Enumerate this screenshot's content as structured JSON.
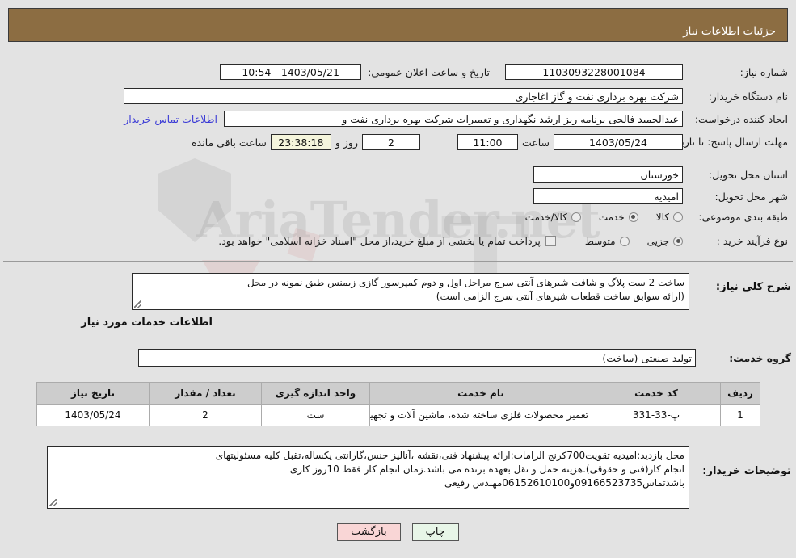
{
  "header": {
    "title": "جزئیات اطلاعات نیاز"
  },
  "form": {
    "need_number_label": "شماره نیاز:",
    "need_number_value": "1103093228001084",
    "announce_datetime_label": "تاریخ و ساعت اعلان عمومی:",
    "announce_datetime_value": "1403/05/21 - 10:54",
    "buyer_org_label": "نام دستگاه خریدار:",
    "buyer_org_value": "شرکت بهره برداری نفت و گاز اغاجاری",
    "requester_label": "ایجاد کننده درخواست:",
    "requester_value": "عبدالحمید فالحی برنامه ریز ارشد نگهداری و تعمیرات شرکت بهره برداری نفت و ",
    "contact_link": "اطلاعات تماس خریدار",
    "deadline_label": "مهلت ارسال پاسخ: تا تاریخ:",
    "deadline_date": "1403/05/24",
    "hour_label": "ساعت",
    "deadline_time": "11:00",
    "days_value": "2",
    "days_label": "روز و",
    "countdown_value": "23:38:18",
    "countdown_label": "ساعت باقی مانده",
    "province_label": "استان محل تحویل:",
    "province_value": "خوزستان",
    "city_label": "شهر محل تحویل:",
    "city_value": "امیدیه",
    "category_label": "طبقه بندی موضوعی:",
    "category_options": [
      {
        "label": "کالا",
        "selected": false
      },
      {
        "label": "خدمت",
        "selected": true
      },
      {
        "label": "کالا/خدمت",
        "selected": false
      }
    ],
    "process_label": "نوع فرآیند خرید :",
    "process_options": [
      {
        "label": "جزیی",
        "selected": true
      },
      {
        "label": "متوسط",
        "selected": false
      }
    ],
    "treasury_checkbox_label": "پرداخت تمام یا بخشی از مبلغ خرید،از محل \"اسناد خزانه اسلامی\" خواهد بود.",
    "treasury_checked": false
  },
  "description": {
    "label": "شرح کلی نیاز:",
    "value": "ساخت 2 ست پلاگ و شافت شیرهای آنتی سرج مراحل اول و دوم کمپرسور گازی زیمنس طبق نمونه در محل\n(ارائه سوابق ساخت قطعات شیرهای  آنتی سرج الزامی است)"
  },
  "services_section": {
    "title": "اطلاعات خدمات مورد نیاز",
    "group_label": "گروه خدمت:",
    "group_value": "تولید صنعتی (ساخت)"
  },
  "table": {
    "headers": [
      "ردیف",
      "کد خدمت",
      "نام خدمت",
      "واحد اندازه گیری",
      "تعداد / مقدار",
      "تاریخ نیاز"
    ],
    "rows": [
      {
        "index": "1",
        "code": "پ-33-331",
        "name": "تعمیر محصولات فلزی ساخته شده، ماشین آلات و تجهیزات",
        "unit": "ست",
        "quantity": "2",
        "need_date": "1403/05/24"
      }
    ]
  },
  "buyer_notes": {
    "label": "توضیحات خریدار:",
    "value": "محل بازدید:امیدیه تقویت700کرنج الزامات:ارائه پیشنهاد فنی،نقشه ،آنالیز جنس،گارانتی یکساله،تقبل کلیه مسئولیتهای\nانجام کار(فنی و حقوقی).هزینه حمل و نقل بعهده برنده می باشد.زمان انجام کار فقط 10روز کاری\nباشدتماس09166523735و06152610100مهندس رفیعی"
  },
  "footer": {
    "back_label": "بازگشت",
    "print_label": "چاپ"
  },
  "watermark": {
    "text": "AriaTender.net",
    "letter": "T"
  },
  "colors": {
    "header_brown": "#8c6d42",
    "link_blue": "#3b3bd6",
    "timer_cream": "#f5f5dc",
    "back_pink": "#f9d6d6",
    "print_green": "#e8f6e8",
    "table_header_gray": "#cdcdcd",
    "page_bg": "#e3e3e3"
  }
}
